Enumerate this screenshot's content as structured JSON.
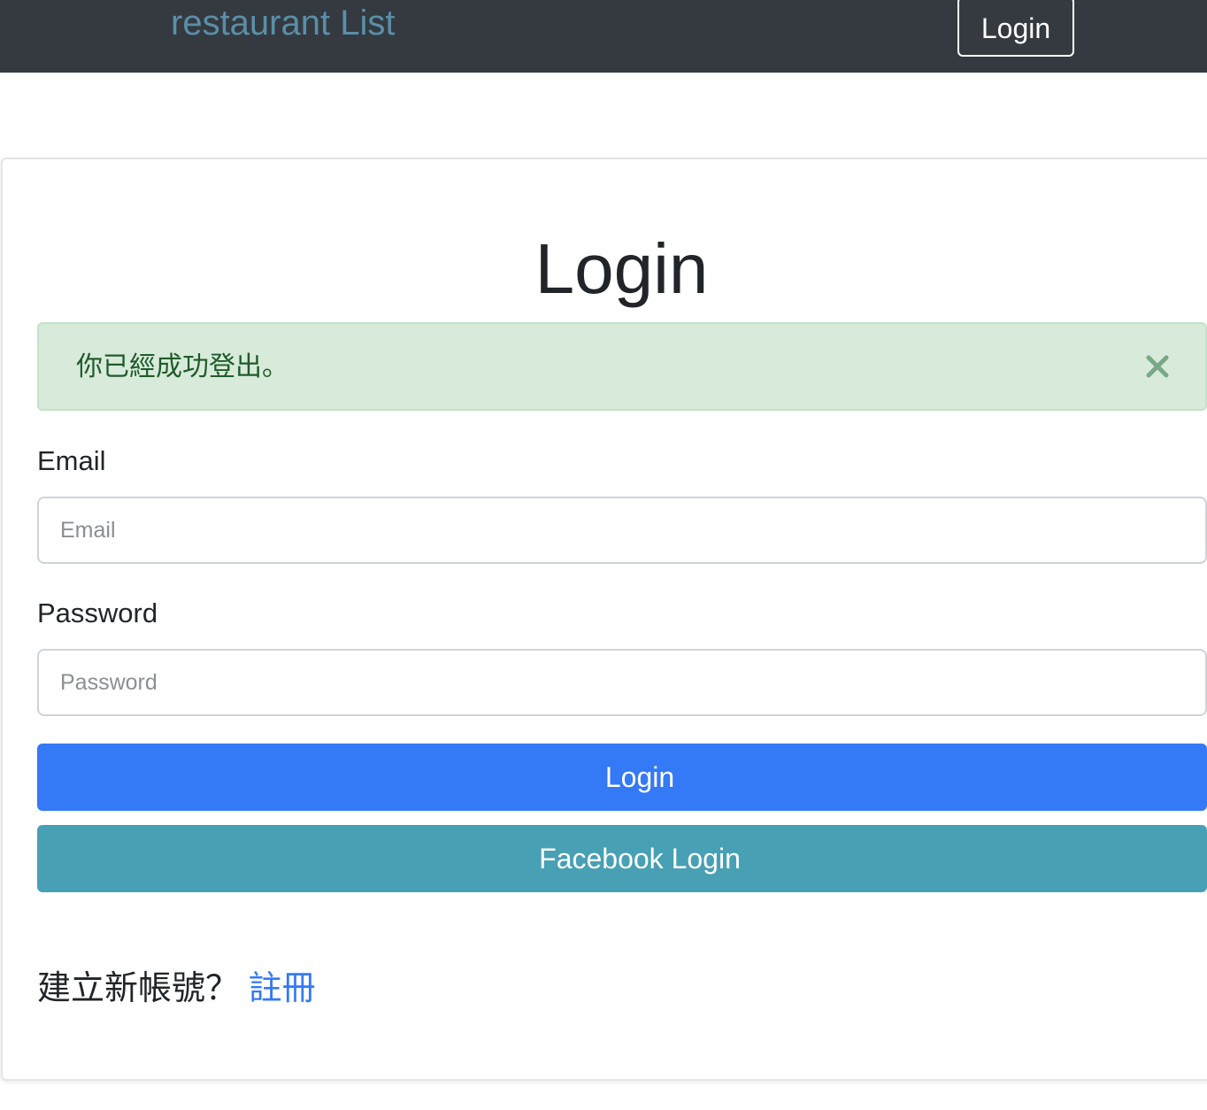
{
  "navbar": {
    "brand": "restaurant List",
    "login_button": "Login"
  },
  "page": {
    "title": "Login"
  },
  "alert": {
    "message": "你已經成功登出。",
    "close_icon": "close-icon"
  },
  "form": {
    "email_label": "Email",
    "email_placeholder": "Email",
    "email_value": "",
    "password_label": "Password",
    "password_placeholder": "Password",
    "password_value": "",
    "submit_label": "Login",
    "facebook_label": "Facebook Login"
  },
  "signup": {
    "prompt": "建立新帳號？",
    "link_label": "註冊"
  },
  "colors": {
    "navbar_bg": "#343a40",
    "brand": "#5a8fa8",
    "alert_bg": "#d8ebdb",
    "alert_text": "#1f5b2a",
    "primary": "#3479f6",
    "info": "#48a0b4"
  }
}
